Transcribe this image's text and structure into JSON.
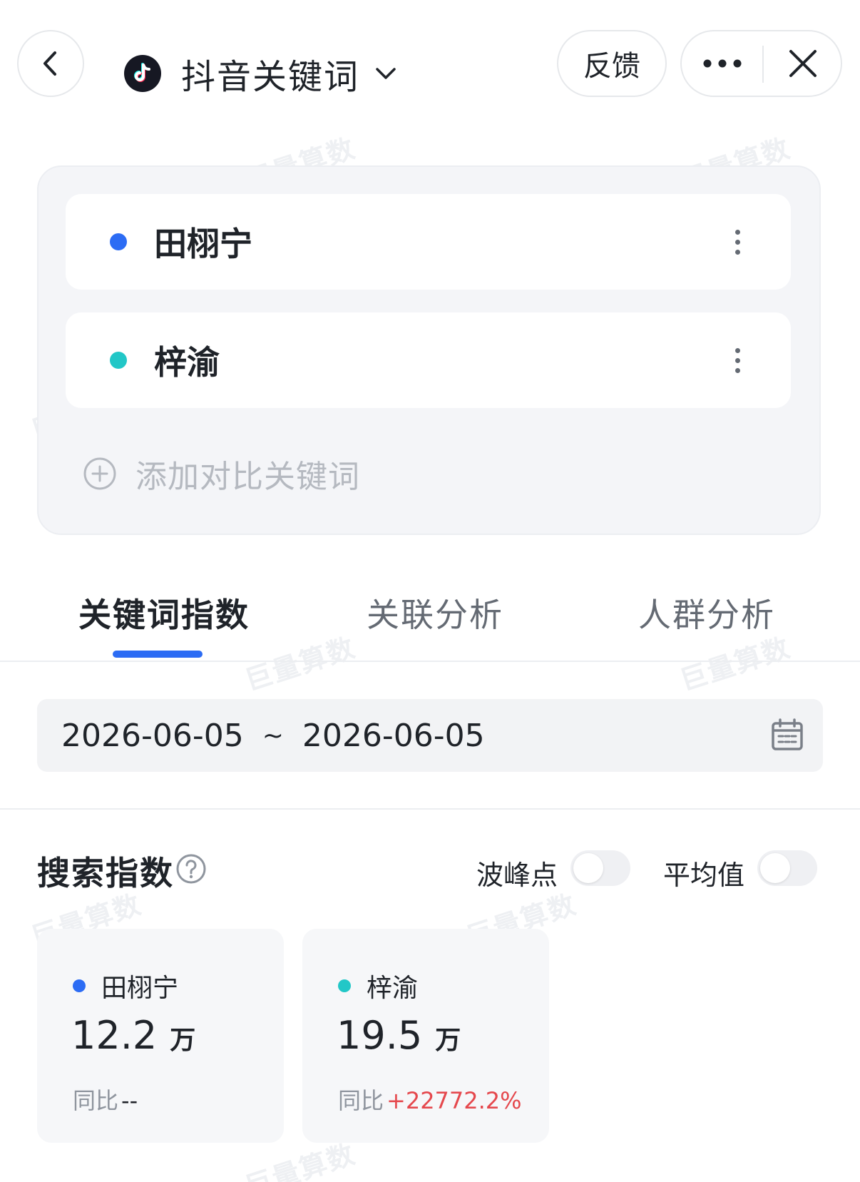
{
  "header": {
    "title": "抖音关键词",
    "feedback_label": "反馈"
  },
  "keywords": [
    {
      "name": "田栩宁",
      "color": "#2c6cf4"
    },
    {
      "name": "梓渝",
      "color": "#22c7c7"
    }
  ],
  "add_keyword_label": "添加对比关键词",
  "tabs": [
    {
      "label": "关键词指数",
      "active": true
    },
    {
      "label": "关联分析",
      "active": false
    },
    {
      "label": "人群分析",
      "active": false
    }
  ],
  "date_range": {
    "start": "2026-06-05",
    "separator": "~",
    "end": "2026-06-05"
  },
  "search_index": {
    "title": "搜索指数",
    "peak_label": "波峰点",
    "avg_label": "平均值",
    "peak_on": false,
    "avg_on": false
  },
  "metrics": [
    {
      "name": "田栩宁",
      "value": "12.2",
      "unit": "万",
      "yoy_label": "同比",
      "yoy_value": "--"
    },
    {
      "name": "梓渝",
      "value": "19.5",
      "unit": "万",
      "yoy_label": "同比",
      "yoy_value": "+22772.2%"
    }
  ],
  "watermark": "巨量算数",
  "colors": {
    "accent": "#2c6cf4",
    "keyword_1": "#2c6cf4",
    "keyword_2": "#22c7c7",
    "positive_change": "#e5484d"
  }
}
